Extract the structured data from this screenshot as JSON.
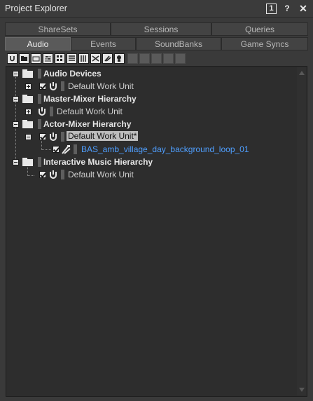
{
  "window": {
    "title": "Project Explorer",
    "badge": "1",
    "help": "?",
    "close": "✕"
  },
  "tabs_row1": [
    "ShareSets",
    "Sessions",
    "Queries"
  ],
  "tabs_row2": [
    "Audio",
    "Events",
    "SoundBanks",
    "Game Syncs"
  ],
  "active_tab": "Audio",
  "toolbar": {
    "enabled": [
      "work-unit-icon",
      "folder-icon",
      "virtual-folder-icon",
      "actor-mixer-icon",
      "random-container-icon",
      "sequence-container-icon",
      "switch-container-icon",
      "blend-container-icon",
      "sound-sfx-icon",
      "sound-voice-icon"
    ],
    "disabled": [
      "music-switch-icon",
      "music-playlist-icon",
      "music-segment-icon",
      "music-track-icon",
      "bus-icon"
    ]
  },
  "tree": {
    "audio_devices": {
      "label": "Audio Devices",
      "child": "Default Work Unit"
    },
    "master_mixer": {
      "label": "Master-Mixer Hierarchy",
      "child": "Default Work Unit"
    },
    "actor_mixer": {
      "label": "Actor-Mixer Hierarchy",
      "child": "Default Work Unit*",
      "sound": "BAS_amb_village_day_background_loop_01"
    },
    "interactive_music": {
      "label": "Interactive Music Hierarchy",
      "child": "Default Work Unit"
    }
  },
  "colors": {
    "sound_link": "#4f9fff",
    "selected_bg": "#bdbdbd"
  }
}
